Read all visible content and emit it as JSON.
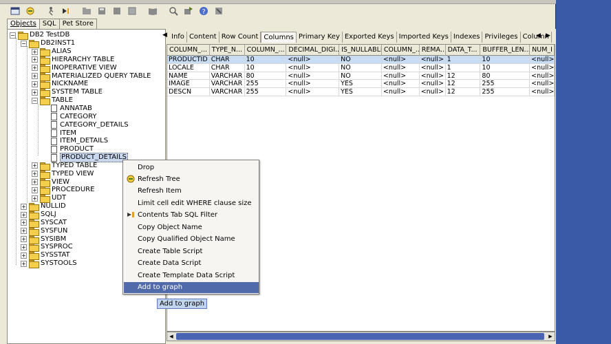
{
  "toolbar": {
    "icons": [
      "new-session-icon",
      "reconnect-icon",
      "run-icon",
      "step-icon",
      "open-folder-icon",
      "save-icon",
      "stop-icon",
      "book-icon",
      "search-icon",
      "refresh-icon",
      "help-icon",
      "tools-icon"
    ]
  },
  "tabs": [
    "Objects",
    "SQL",
    "Pet Store"
  ],
  "tree": {
    "root": "DB2 TestDB",
    "schema": "DB2INST1",
    "schema_children": [
      "ALIAS",
      "HIERARCHY TABLE",
      "INOPERATIVE VIEW",
      "MATERIALIZED QUERY TABLE",
      "NICKNAME",
      "SYSTEM TABLE",
      "TABLE"
    ],
    "tables": [
      "ANNATAB",
      "CATEGORY",
      "CATEGORY_DETAILS",
      "ITEM",
      "ITEM_DETAILS",
      "PRODUCT",
      "PRODUCT_DETAILS"
    ],
    "after_table": [
      "TYPED TABLE",
      "TYPED VIEW",
      "VIEW",
      "PROCEDURE",
      "UDT"
    ],
    "schemas": [
      "NULLID",
      "SQLJ",
      "SYSCAT",
      "SYSFUN",
      "SYSIBM",
      "SYSPROC",
      "SYSSTAT",
      "SYSTOOLS"
    ]
  },
  "right_tabs": [
    "Info",
    "Content",
    "Row Count",
    "Columns",
    "Primary Key",
    "Exported Keys",
    "Imported Keys",
    "Indexes",
    "Privileges",
    "Column"
  ],
  "active_right_tab": "Columns",
  "grid": {
    "headers": [
      "COLUMN_...",
      "TYPE_N...",
      "COLUMN_...",
      "DECIMAL_DIGI...",
      "IS_NULLABLE",
      "COLUMN_...",
      "REMA...",
      "DATA_T...",
      "BUFFER_LEN...",
      "NUM_I"
    ],
    "rows": [
      [
        "PRODUCTID",
        "CHAR",
        "10",
        "<null>",
        "NO",
        "<null>",
        "<null>",
        "1",
        "10",
        "<null>"
      ],
      [
        "LOCALE",
        "CHAR",
        "10",
        "<null>",
        "NO",
        "<null>",
        "<null>",
        "1",
        "10",
        "<null>"
      ],
      [
        "NAME",
        "VARCHAR",
        "80",
        "<null>",
        "NO",
        "<null>",
        "<null>",
        "12",
        "80",
        "<null>"
      ],
      [
        "IMAGE",
        "VARCHAR",
        "255",
        "<null>",
        "YES",
        "<null>",
        "<null>",
        "12",
        "255",
        "<null>"
      ],
      [
        "DESCN",
        "VARCHAR",
        "255",
        "<null>",
        "YES",
        "<null>",
        "<null>",
        "12",
        "255",
        "<null>"
      ]
    ]
  },
  "context_menu": [
    {
      "label": "Drop",
      "icon": ""
    },
    {
      "label": "Refresh Tree",
      "icon": "refresh-icon"
    },
    {
      "label": "Refresh Item",
      "icon": ""
    },
    {
      "label": "Limit cell edit WHERE clause size",
      "icon": ""
    },
    {
      "label": "Contents Tab SQL Filter",
      "icon": "filter-icon"
    },
    {
      "label": "Copy Object Name",
      "icon": ""
    },
    {
      "label": "Copy Qualified Object Name",
      "icon": ""
    },
    {
      "label": "Create Table Script",
      "icon": ""
    },
    {
      "label": "Create Data Script",
      "icon": ""
    },
    {
      "label": "Create Template Data Script",
      "icon": ""
    },
    {
      "label": "Add to graph",
      "icon": ""
    }
  ],
  "tooltip": "Add to graph"
}
